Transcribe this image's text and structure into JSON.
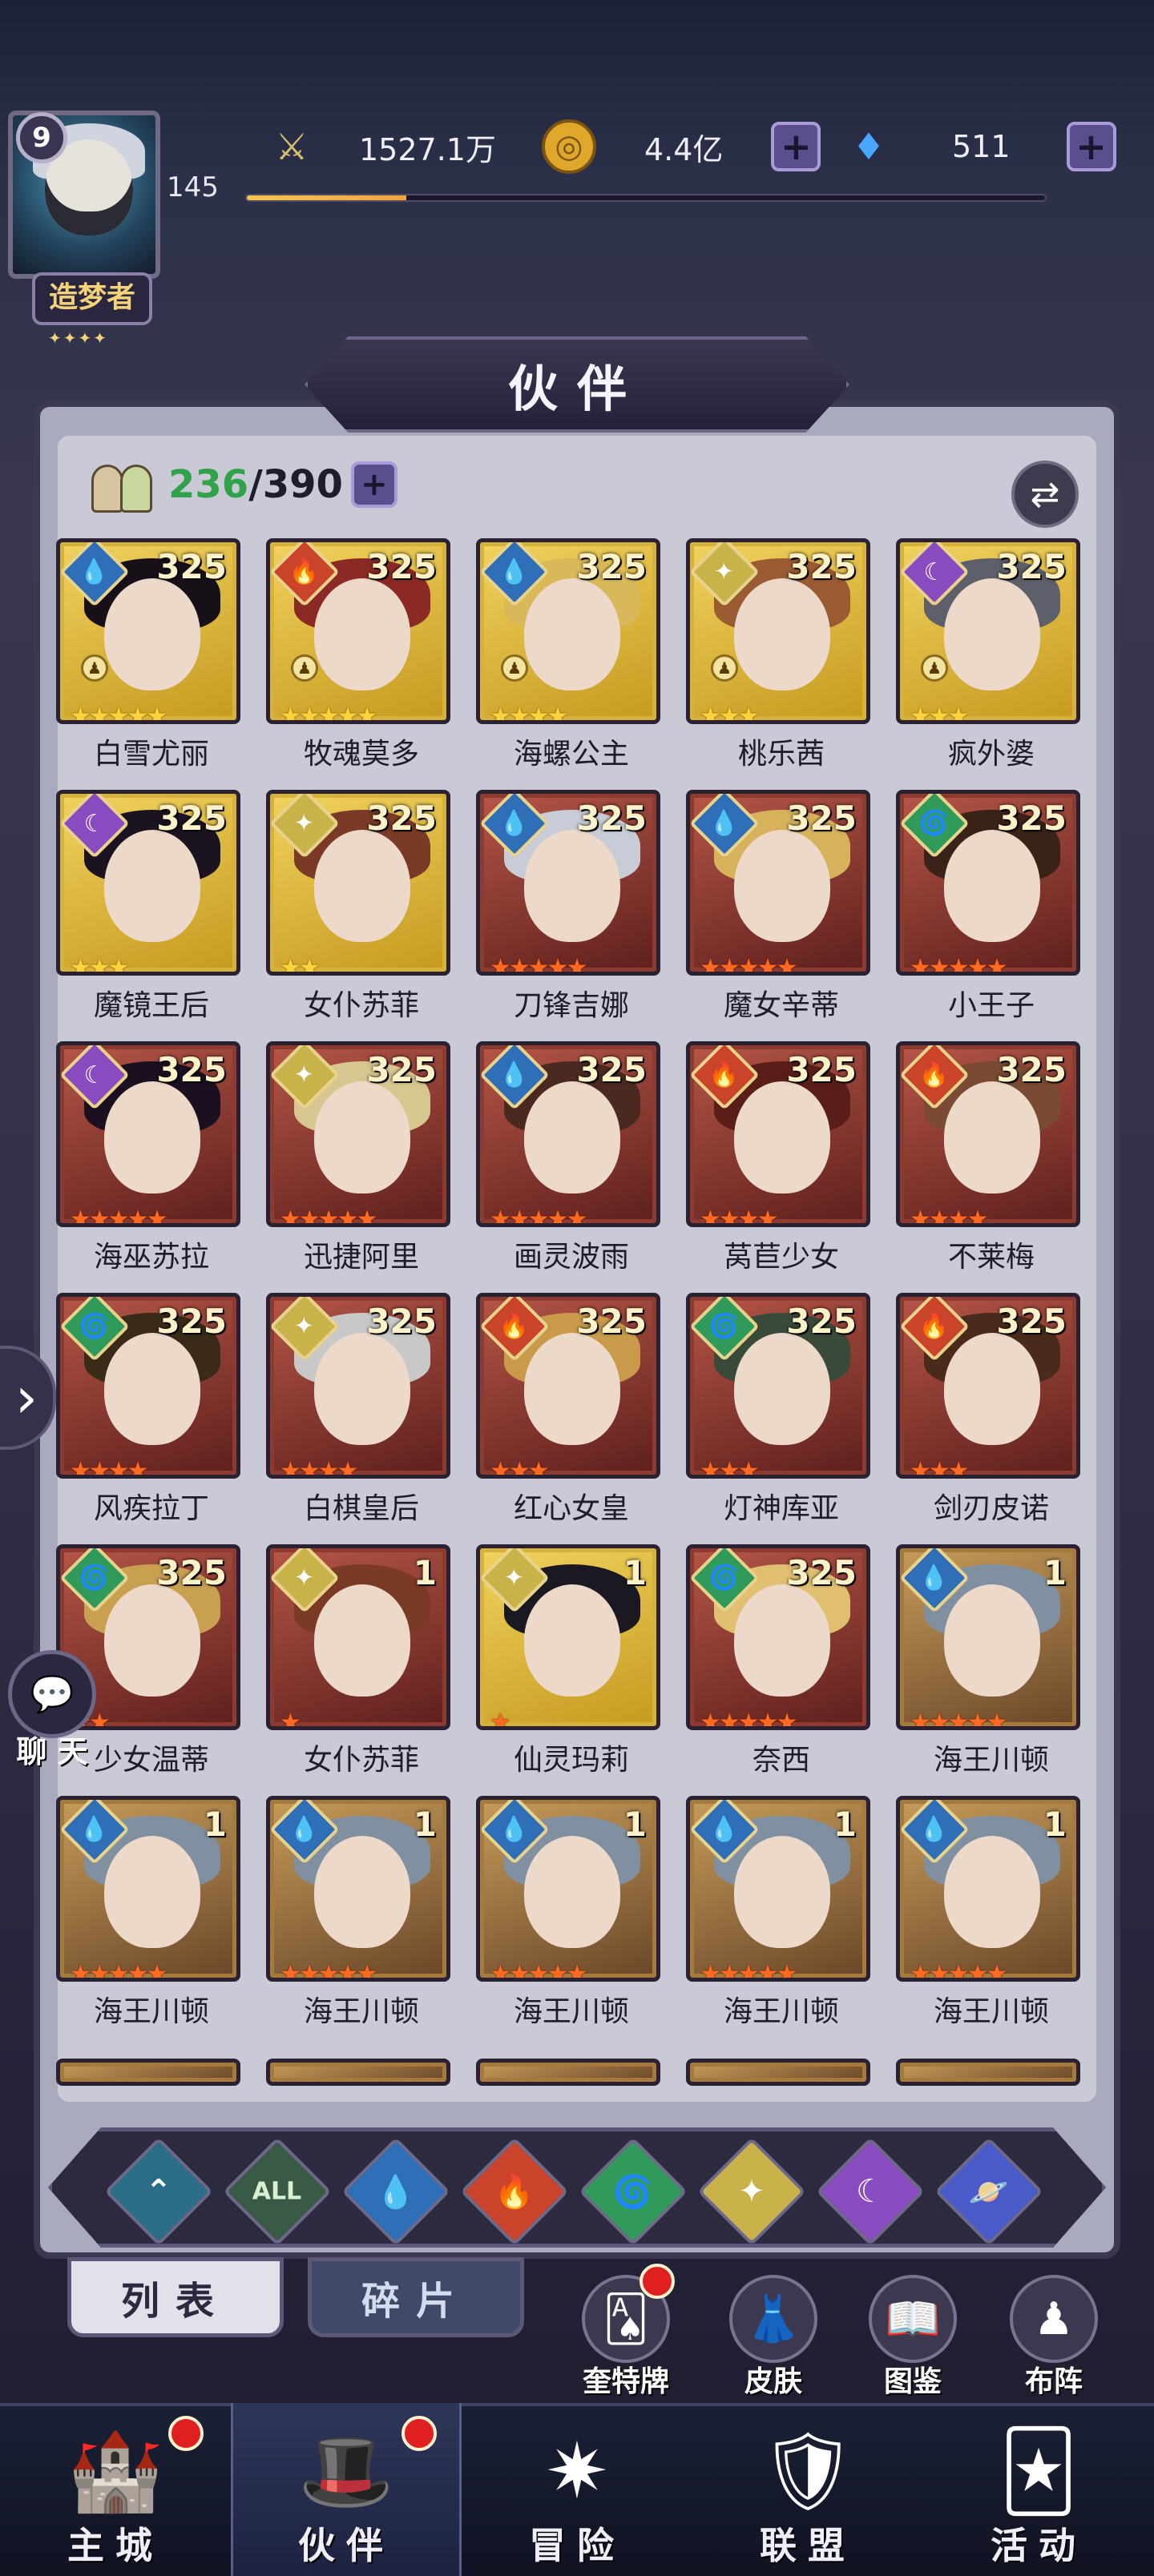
{
  "player": {
    "level": "9",
    "exp_level": "145",
    "title": "造梦者",
    "title_stars": "✦✦✦✦",
    "exp_progress": 0.2
  },
  "resources": {
    "power": "1527.1万",
    "gold": "4.4亿",
    "gems": "511"
  },
  "panel": {
    "title": "伙伴",
    "count_current": "236",
    "count_max": "/390"
  },
  "heroes": [
    {
      "name": "白雪尤丽",
      "level": "325",
      "element": "water",
      "frame": "gold",
      "stars": 5,
      "star_color": "y",
      "rank": true,
      "hair": "#171019"
    },
    {
      "name": "牧魂莫多",
      "level": "325",
      "element": "fire",
      "frame": "gold",
      "stars": 5,
      "star_color": "y",
      "rank": true,
      "hair": "#8b2a25"
    },
    {
      "name": "海螺公主",
      "level": "325",
      "element": "water",
      "frame": "gold",
      "stars": 4,
      "star_color": "y",
      "rank": true,
      "hair": "#d9b85a"
    },
    {
      "name": "桃乐茜",
      "level": "325",
      "element": "light",
      "frame": "gold",
      "stars": 3,
      "star_color": "y",
      "rank": true,
      "hair": "#9a5a32"
    },
    {
      "name": "疯外婆",
      "level": "325",
      "element": "dark",
      "frame": "gold",
      "stars": 3,
      "star_color": "y",
      "rank": true,
      "hair": "#5d5f6a"
    },
    {
      "name": "魔镜王后",
      "level": "325",
      "element": "dark",
      "frame": "gold",
      "stars": 3,
      "star_color": "y",
      "rank": false,
      "hair": "#1b1420"
    },
    {
      "name": "女仆苏菲",
      "level": "325",
      "element": "light",
      "frame": "gold",
      "stars": 2,
      "star_color": "y",
      "rank": false,
      "hair": "#7a3a26"
    },
    {
      "name": "刀锋吉娜",
      "level": "325",
      "element": "water",
      "frame": "red",
      "stars": 5,
      "star_color": "o",
      "rank": false,
      "hair": "#c7ccd6"
    },
    {
      "name": "魔女辛蒂",
      "level": "325",
      "element": "water",
      "frame": "red",
      "stars": 5,
      "star_color": "o",
      "rank": false,
      "hair": "#d6b25c"
    },
    {
      "name": "小王子",
      "level": "325",
      "element": "wind",
      "frame": "red",
      "stars": 5,
      "star_color": "o",
      "rank": false,
      "hair": "#3a2218"
    },
    {
      "name": "海巫苏拉",
      "level": "325",
      "element": "dark",
      "frame": "red",
      "stars": 5,
      "star_color": "o",
      "rank": false,
      "hair": "#1a1020"
    },
    {
      "name": "迅捷阿里",
      "level": "325",
      "element": "light",
      "frame": "red",
      "stars": 5,
      "star_color": "o",
      "rank": false,
      "hair": "#d8c690"
    },
    {
      "name": "画灵波雨",
      "level": "325",
      "element": "water",
      "frame": "red",
      "stars": 5,
      "star_color": "o",
      "rank": false,
      "hair": "#4a2a20"
    },
    {
      "name": "莴苣少女",
      "level": "325",
      "element": "fire",
      "frame": "red",
      "stars": 4,
      "star_color": "o",
      "rank": false,
      "hair": "#5a1e18"
    },
    {
      "name": "不莱梅",
      "level": "325",
      "element": "fire",
      "frame": "red",
      "stars": 4,
      "star_color": "o",
      "rank": false,
      "hair": "#7a4a32"
    },
    {
      "name": "风疾拉丁",
      "level": "325",
      "element": "wind",
      "frame": "red",
      "stars": 4,
      "star_color": "o",
      "rank": false,
      "hair": "#3a2a18"
    },
    {
      "name": "白棋皇后",
      "level": "325",
      "element": "light",
      "frame": "red",
      "stars": 4,
      "star_color": "o",
      "rank": false,
      "hair": "#c8c8c8"
    },
    {
      "name": "红心女皇",
      "level": "325",
      "element": "fire",
      "frame": "red",
      "stars": 3,
      "star_color": "o",
      "rank": false,
      "hair": "#c89a4a"
    },
    {
      "name": "灯神库亚",
      "level": "325",
      "element": "wind",
      "frame": "red",
      "stars": 3,
      "star_color": "o",
      "rank": false,
      "hair": "#3a4a3a"
    },
    {
      "name": "剑刃皮诺",
      "level": "325",
      "element": "fire",
      "frame": "red",
      "stars": 3,
      "star_color": "o",
      "rank": false,
      "hair": "#4a2a1a"
    },
    {
      "name": "少女温蒂",
      "level": "325",
      "element": "wind",
      "frame": "red",
      "stars": 2,
      "star_color": "o",
      "rank": false,
      "hair": "#c8a050"
    },
    {
      "name": "女仆苏菲",
      "level": "1",
      "element": "light",
      "frame": "red",
      "stars": 1,
      "star_color": "o",
      "rank": false,
      "hair": "#7a3a26"
    },
    {
      "name": "仙灵玛莉",
      "level": "1",
      "element": "light",
      "frame": "gold",
      "stars": 1,
      "star_color": "o",
      "rank": false,
      "hair": "#1a1820"
    },
    {
      "name": "奈西",
      "level": "325",
      "element": "wind",
      "frame": "red",
      "stars": 5,
      "star_color": "o",
      "rank": false,
      "hair": "#e0c070"
    },
    {
      "name": "海王川顿",
      "level": "1",
      "element": "water",
      "frame": "brown",
      "stars": 5,
      "star_color": "o",
      "rank": false,
      "hair": "#8090a0"
    },
    {
      "name": "海王川顿",
      "level": "1",
      "element": "water",
      "frame": "brown",
      "stars": 5,
      "star_color": "o",
      "rank": false,
      "hair": "#8090a0"
    },
    {
      "name": "海王川顿",
      "level": "1",
      "element": "water",
      "frame": "brown",
      "stars": 5,
      "star_color": "o",
      "rank": false,
      "hair": "#8090a0"
    },
    {
      "name": "海王川顿",
      "level": "1",
      "element": "water",
      "frame": "brown",
      "stars": 5,
      "star_color": "o",
      "rank": false,
      "hair": "#8090a0"
    },
    {
      "name": "海王川顿",
      "level": "1",
      "element": "water",
      "frame": "brown",
      "stars": 5,
      "star_color": "o",
      "rank": false,
      "hair": "#8090a0"
    },
    {
      "name": "海王川顿",
      "level": "1",
      "element": "water",
      "frame": "brown",
      "stars": 5,
      "star_color": "o",
      "rank": false,
      "hair": "#8090a0"
    }
  ],
  "element_styles": {
    "water": {
      "bg": "#2f6fb8",
      "glyph": "💧"
    },
    "fire": {
      "bg": "#c9442a",
      "glyph": "🔥"
    },
    "light": {
      "bg": "#c9b24a",
      "glyph": "✦"
    },
    "dark": {
      "bg": "#8a4ac0",
      "glyph": "☾"
    },
    "wind": {
      "bg": "#2f9a5a",
      "glyph": "🌀"
    }
  },
  "filters": [
    {
      "id": "all-rare",
      "glyph": "⌃",
      "bg": "#2b6d86"
    },
    {
      "id": "all",
      "glyph": "ALL",
      "bg": "#3a5a48"
    },
    {
      "id": "water",
      "glyph": "💧",
      "bg": "#2f6fb8"
    },
    {
      "id": "fire",
      "glyph": "🔥",
      "bg": "#c9442a"
    },
    {
      "id": "wind",
      "glyph": "🌀",
      "bg": "#2f9a5a"
    },
    {
      "id": "light",
      "glyph": "✦",
      "bg": "#c9b24a"
    },
    {
      "id": "dark",
      "glyph": "☾",
      "bg": "#8a4ac0"
    },
    {
      "id": "cosmic",
      "glyph": "🪐",
      "bg": "#4a5ac8"
    }
  ],
  "tabs": {
    "list": "列表",
    "fragments": "碎片"
  },
  "side_buttons": [
    {
      "label": "奎特牌",
      "glyph": "🂡",
      "badge": true
    },
    {
      "label": "皮肤",
      "glyph": "👗",
      "badge": false
    },
    {
      "label": "图鉴",
      "glyph": "📖",
      "badge": false
    },
    {
      "label": "布阵",
      "glyph": "♟",
      "badge": false
    }
  ],
  "nav": [
    {
      "label": "主城",
      "glyph": "🏰",
      "badge": true,
      "active": false
    },
    {
      "label": "伙伴",
      "glyph": "🎩",
      "badge": true,
      "active": true
    },
    {
      "label": "冒险",
      "glyph": "✷",
      "badge": false,
      "active": false
    },
    {
      "label": "联盟",
      "glyph": "🛡",
      "badge": false,
      "active": false
    },
    {
      "label": "活动",
      "glyph": "🃏",
      "badge": false,
      "active": false
    }
  ],
  "chat": {
    "label": "聊 天",
    "glyph": "💬"
  }
}
